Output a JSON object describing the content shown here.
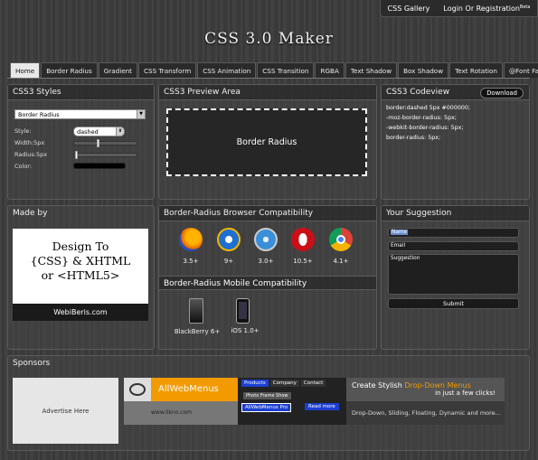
{
  "topbar": {
    "gallery": "CSS Gallery",
    "login": "Login Or Registration",
    "beta": "Beta"
  },
  "logo": "CSS 3.0 Maker",
  "tabs": [
    "Home",
    "Border Radius",
    "Gradient",
    "CSS Transform",
    "CSS Animation",
    "CSS Transition",
    "RGBA",
    "Text Shadow",
    "Box Shadow",
    "Text Rotation",
    "@Font Face"
  ],
  "styles": {
    "title": "CSS3 Styles",
    "property": "Border Radius",
    "style_label": "Style:",
    "style_value": "dashed",
    "width_label": "Width:5px",
    "radius_label": "Radius:5px",
    "color_label": "Color:",
    "width_fraction": 0.38,
    "radius_fraction": 0.02
  },
  "preview": {
    "title": "CSS3 Preview Area",
    "box_text": "Border Radius"
  },
  "codeview": {
    "title": "CSS3 Codeview",
    "download": "Download",
    "lines": [
      "border:dashed 5px #000000;",
      "-moz-border-radius: 5px;",
      "-webkit-border-radius: 5px;",
      "border-radius: 5px;"
    ]
  },
  "madeby": {
    "title": "Made by",
    "badge_lines": [
      "Design To",
      "{CSS} & XHTML",
      "or  <HTML5>"
    ],
    "badge_footer": "WebiBeris.com"
  },
  "compat": {
    "title": "Border-Radius Browser Compatibility",
    "browsers": [
      {
        "name": "firefox-icon",
        "version": "3.5+",
        "color": "#e66000"
      },
      {
        "name": "ie-icon",
        "version": "9+",
        "color": "#1f6fd0"
      },
      {
        "name": "safari-icon",
        "version": "3.0+",
        "color": "#3a8fd9"
      },
      {
        "name": "opera-icon",
        "version": "10.5+",
        "color": "#cc0f16"
      },
      {
        "name": "chrome-icon",
        "version": "4.1+",
        "color": "#4caf50"
      }
    ],
    "mobile_title": "Border-Radius Mobile Compatibility",
    "mobile": [
      {
        "name": "blackberry-icon",
        "version": "BlackBerry 6+"
      },
      {
        "name": "iphone-icon",
        "version": "iOS 1.0+"
      }
    ]
  },
  "suggestion": {
    "title": "Your Suggestion",
    "name_placeholder": "Name",
    "email_placeholder": "Email",
    "suggestion_placeholder": "Suggestion",
    "submit": "Submit"
  },
  "sponsors": {
    "title": "Sponsors",
    "advertise": "Advertise Here",
    "banner": {
      "brand": "AllWebMenus",
      "url": "www.likno.com",
      "menu": [
        "Products",
        "Company",
        "Contact"
      ],
      "menu2": "Photo Frame Show",
      "pro": "AllWebMenus Pro",
      "more": "Read more",
      "headline_pre": "Create Stylish ",
      "headline_em": "Drop-Down Menus",
      "headline_post": "in just a few clicks!",
      "tagline": "Drop-Down, Sliding, Floating, Dynamic and more..."
    }
  }
}
